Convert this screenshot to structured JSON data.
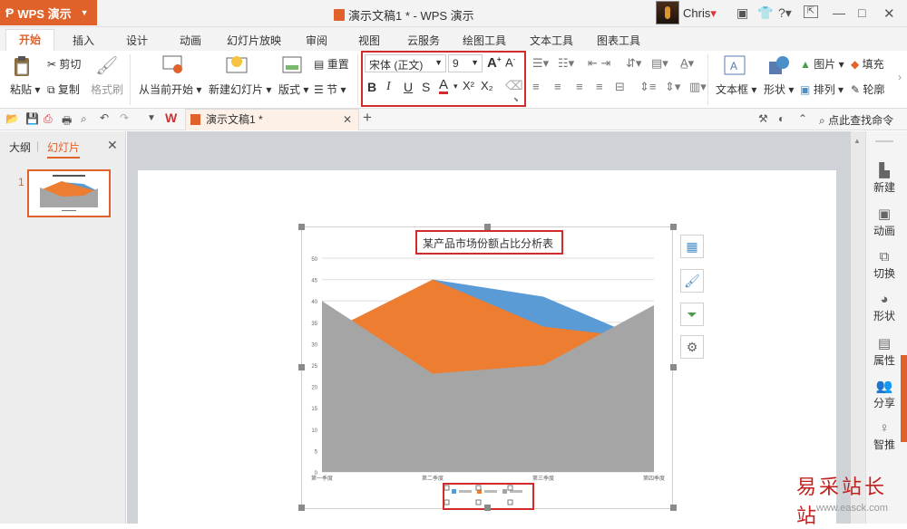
{
  "app": {
    "name": "WPS 演示",
    "window_title": "演示文稿1 * - WPS 演示",
    "user": "Chris"
  },
  "ribbon_tabs": [
    "开始",
    "插入",
    "设计",
    "动画",
    "幻灯片放映",
    "审阅",
    "视图",
    "云服务",
    "绘图工具",
    "文本工具",
    "图表工具"
  ],
  "clipboard": {
    "paste": "粘贴",
    "cut": "剪切",
    "copy": "复制",
    "format_painter": "格式刷"
  },
  "slides_group": {
    "from_current": "从当前开始",
    "new_slide": "新建幻灯片",
    "layout": "版式",
    "reset": "重置",
    "section": "节"
  },
  "font": {
    "family": "宋体 (正文)",
    "size": "9"
  },
  "format_buttons": {
    "bold": "B",
    "italic": "I",
    "underline": "U",
    "strike": "S",
    "color": "A",
    "superscript": "X²",
    "subscript": "X₂"
  },
  "insert_group": {
    "textbox": "文本框",
    "shape": "形状",
    "picture": "图片",
    "arrange": "排列",
    "fill": "填充",
    "outline": "轮廓"
  },
  "doc_tab": {
    "title": "演示文稿1 *"
  },
  "quick_search": "点此查找命令",
  "left_panel": {
    "tab_outline": "大纲",
    "tab_slides": "幻灯片",
    "slide_number": "1"
  },
  "right_bar": [
    {
      "label": "新建",
      "icon": "new-icon"
    },
    {
      "label": "动画",
      "icon": "animation-icon"
    },
    {
      "label": "切换",
      "icon": "transition-icon"
    },
    {
      "label": "形状",
      "icon": "shape-icon"
    },
    {
      "label": "属性",
      "icon": "property-icon"
    },
    {
      "label": "分享",
      "icon": "share-icon"
    },
    {
      "label": "智推",
      "icon": "recommend-icon"
    }
  ],
  "chart_data": {
    "type": "area",
    "title": "某产品市场份额占比分析表",
    "categories": [
      "第一季度",
      "第二季度",
      "第三季度",
      "第四季度"
    ],
    "ylim": [
      0,
      50
    ],
    "yticks": [
      0,
      5,
      10,
      15,
      20,
      25,
      30,
      35,
      40,
      45,
      50
    ],
    "series": [
      {
        "values": [
          30,
          45,
          41,
          30
        ],
        "color": "#5b9bd5"
      },
      {
        "values": [
          32,
          45,
          34,
          31
        ],
        "color": "#ed7d31"
      },
      {
        "values": [
          40,
          23,
          25,
          39
        ],
        "color": "#a5a5a5"
      }
    ],
    "legend_position": "bottom",
    "grid": true
  },
  "watermark": {
    "text": "易采站长站",
    "url": "www.easck.com"
  }
}
